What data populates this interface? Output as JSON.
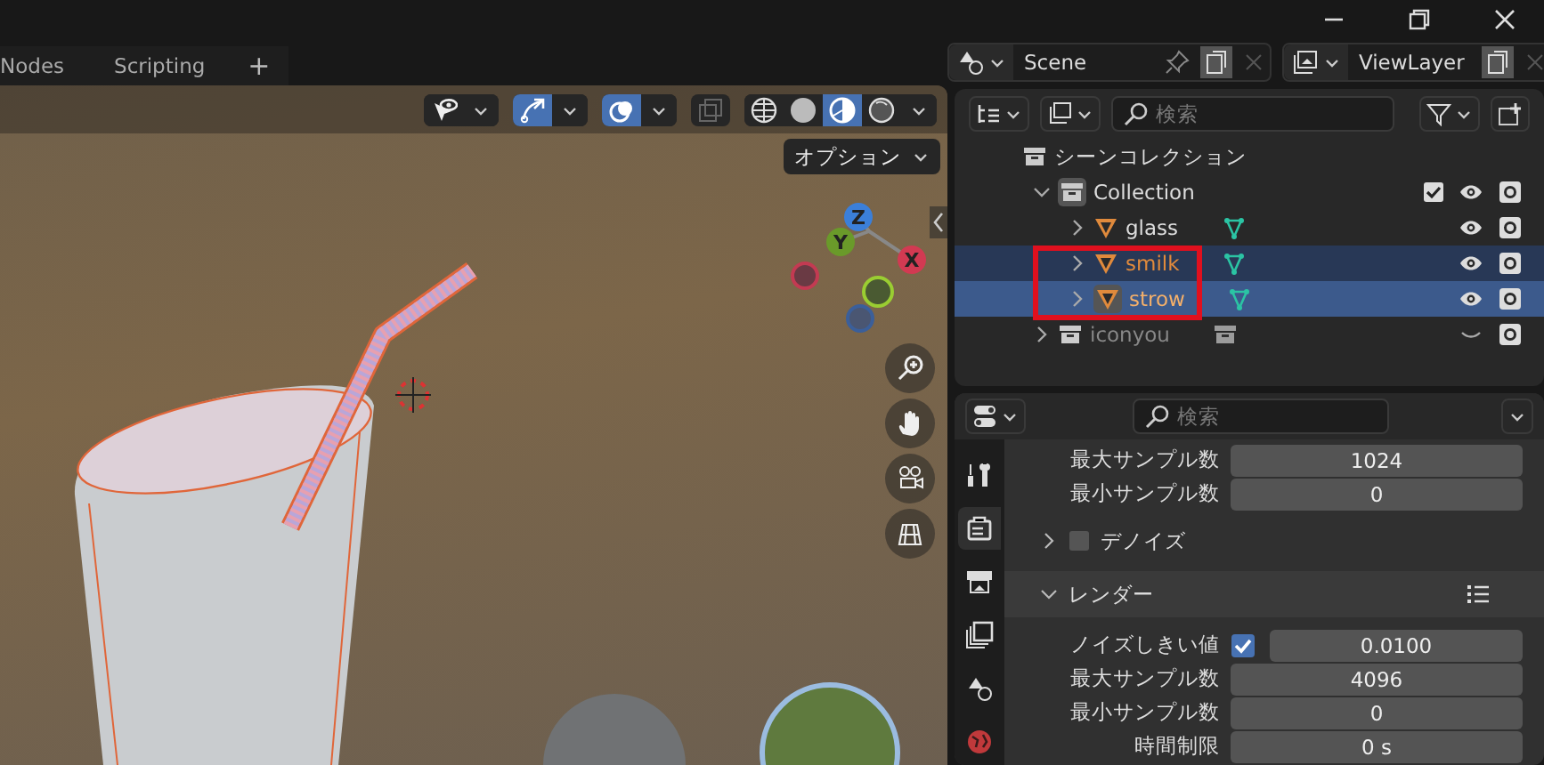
{
  "workspace_tabs": [
    {
      "label": "Nodes",
      "selected": false
    },
    {
      "label": "Scripting",
      "selected": false
    }
  ],
  "add_tab": "+",
  "viewport": {
    "header": {
      "gizmo_on": true,
      "overlay_on": true,
      "shading_modes": [
        {
          "kind": "wireframe",
          "selected": false
        },
        {
          "kind": "solid",
          "selected": false
        },
        {
          "kind": "material",
          "selected": true
        },
        {
          "kind": "rendered",
          "selected": false
        }
      ]
    },
    "options_button": "オプション",
    "gizmo": {
      "axes": [
        {
          "label": "Z",
          "color": "#3b7fd9"
        },
        {
          "label": "Y",
          "color": "#6a9a2a"
        },
        {
          "label": "X",
          "color": "#d23a52"
        }
      ]
    }
  },
  "scene_selector": {
    "value": "Scene"
  },
  "view_layer_selector": {
    "value": "ViewLayer"
  },
  "outliner": {
    "search": {
      "placeholder": "検索"
    },
    "tree": [
      {
        "kind": "scene-collection",
        "label": "シーンコレクション",
        "children": [
          {
            "kind": "collection",
            "label": "Collection",
            "expanded": true,
            "checked": true,
            "visible": true,
            "selected": false,
            "children": [
              {
                "kind": "object",
                "label": "glass",
                "expanded": false,
                "visible": true,
                "selected": false,
                "active": false
              },
              {
                "kind": "object",
                "label": "smilk",
                "expanded": false,
                "visible": true,
                "selected": true,
                "active": false
              },
              {
                "kind": "object",
                "label": "strow",
                "expanded": false,
                "visible": true,
                "selected": true,
                "active": true
              }
            ]
          },
          {
            "kind": "collection",
            "label": "iconyou",
            "expanded": false,
            "visible": false,
            "selected": false
          }
        ]
      }
    ]
  },
  "properties": {
    "search": {
      "placeholder": "検索"
    },
    "tabs": [
      {
        "kind": "tool",
        "selected": false
      },
      {
        "kind": "render",
        "selected": true
      },
      {
        "kind": "output",
        "selected": false
      },
      {
        "kind": "view-layer",
        "selected": false
      },
      {
        "kind": "scene",
        "selected": false
      },
      {
        "kind": "world",
        "selected": false
      }
    ],
    "rows": [
      {
        "kind": "field",
        "label": "最大サンプル数",
        "value": "1024"
      },
      {
        "kind": "field",
        "label": "最小サンプル数",
        "value": "0"
      },
      {
        "kind": "panel",
        "label": "デノイズ",
        "expanded": false,
        "checked": false
      },
      {
        "kind": "panel",
        "label": "レンダー",
        "expanded": true
      },
      {
        "kind": "check-field",
        "label": "ノイズしきい値",
        "checked": true,
        "value": "0.0100"
      },
      {
        "kind": "field",
        "label": "最大サンプル数",
        "value": "4096"
      },
      {
        "kind": "field",
        "label": "最小サンプル数",
        "value": "0"
      },
      {
        "kind": "field",
        "label": "時間制限",
        "value": "0 s"
      }
    ]
  }
}
